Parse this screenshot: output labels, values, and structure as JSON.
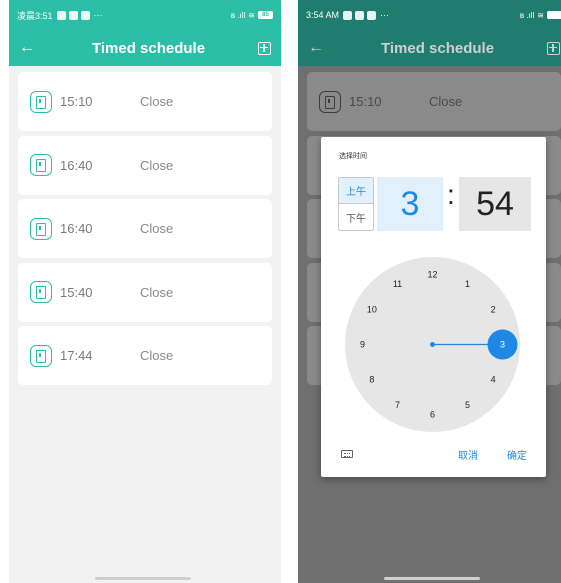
{
  "left": {
    "status": {
      "time": "凌晨3:51",
      "ellipsis": "···",
      "signal": "ʙ .ıll",
      "battery": "85"
    },
    "appbar": {
      "back": "←",
      "title": "Timed schedule"
    },
    "schedules": [
      {
        "time": "15:10",
        "action": "Close"
      },
      {
        "time": "16:40",
        "action": "Close"
      },
      {
        "time": "16:40",
        "action": "Close"
      },
      {
        "time": "15:40",
        "action": "Close"
      },
      {
        "time": "17:44",
        "action": "Close"
      }
    ]
  },
  "right": {
    "status": {
      "time": "3:54 AM",
      "ellipsis": "···",
      "signal": "ʙ .ıll"
    },
    "appbar": {
      "back": "←",
      "title": "Timed schedule"
    },
    "schedules": [
      {
        "time": "15:10",
        "action": "Close"
      }
    ],
    "dialog": {
      "title": "选择时间",
      "am": "上午",
      "pm": "下午",
      "hour": "3",
      "colon": ":",
      "minute": "54",
      "selected_hour": 3,
      "cancel": "取消",
      "ok": "确定",
      "dial": [
        "12",
        "1",
        "2",
        "3",
        "4",
        "5",
        "6",
        "7",
        "8",
        "9",
        "10",
        "11"
      ]
    }
  },
  "colors": {
    "accent": "#2cbfa7",
    "dim_accent": "#1e7d6e",
    "picker_blue": "#1e88e5"
  }
}
